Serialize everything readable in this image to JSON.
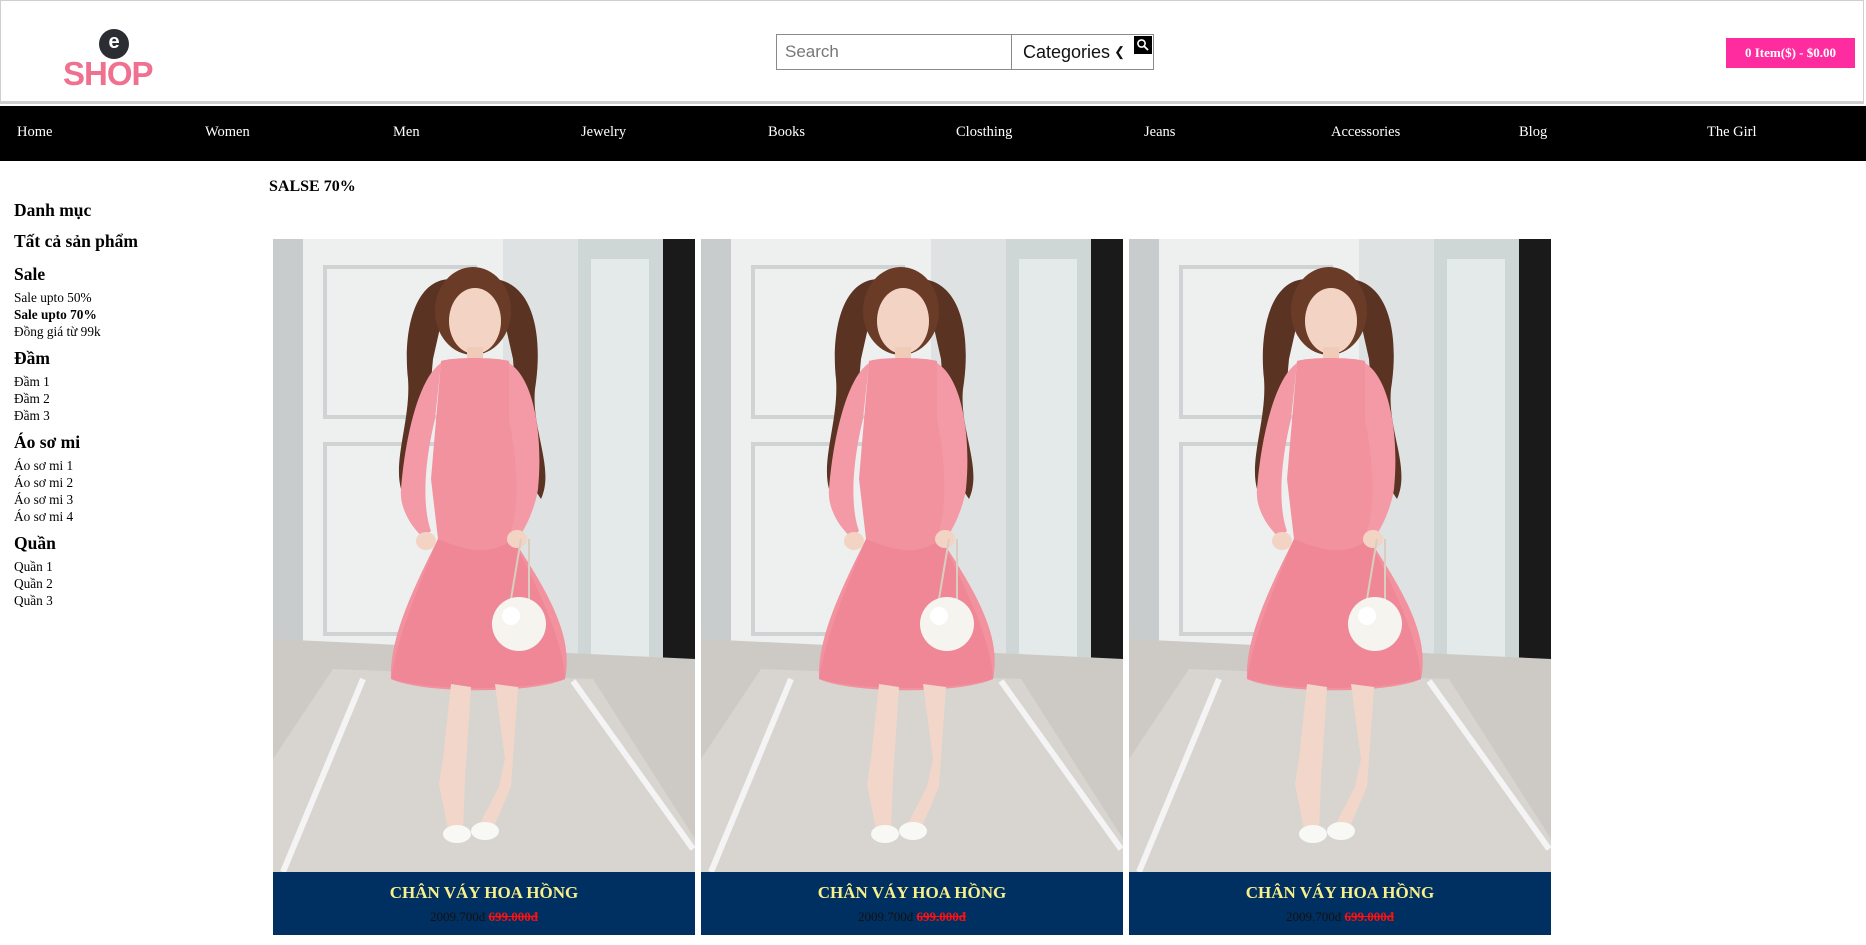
{
  "brand": {
    "logo_letter": "e",
    "logo_text": "SHOP"
  },
  "search": {
    "placeholder": "Search",
    "category_selected": "Categories"
  },
  "cart": {
    "label": "0 Item($) - $0.00"
  },
  "nav": {
    "items": [
      "Home",
      "Women",
      "Men",
      "Jewelry",
      "Books",
      "Closthing",
      "Jeans",
      "Accessories",
      "Blog",
      "The Girl"
    ]
  },
  "sidebar": {
    "title": "Danh mục",
    "all_products": "Tất cả sản phẩm",
    "groups": [
      {
        "heading": "Sale",
        "links": [
          "Sale upto 50%",
          "Sale upto 70%",
          "Đồng giá từ 99k"
        ]
      },
      {
        "heading": "Đầm",
        "links": [
          "Đầm 1",
          "Đầm 2",
          "Đầm 3"
        ]
      },
      {
        "heading": "Áo sơ mi",
        "links": [
          "Áo sơ mi 1",
          "Áo sơ mi 2",
          "Áo sơ mi 3",
          "Áo sơ mi 4"
        ]
      },
      {
        "heading": "Quần",
        "links": [
          "Quần 1",
          "Quần 2",
          "Quần 3"
        ]
      }
    ]
  },
  "section": {
    "title": "SALSE 70%"
  },
  "products": [
    {
      "name": "CHÂN VÁY HOA HỒNG",
      "price": "2009.700đ",
      "sale_price": "699.000đ"
    },
    {
      "name": "CHÂN VÁY HOA HỒNG",
      "price": "2009.700đ",
      "sale_price": "699.000đ"
    },
    {
      "name": "CHÂN VÁY HOA HỒNG",
      "price": "2009.700đ",
      "sale_price": "699.000đ"
    }
  ],
  "colors": {
    "accent": "#ff2ca0",
    "nav_bg": "#000000",
    "caption_bg": "#003061",
    "product_name": "#f9f08a",
    "sale_price": "#ff1010"
  }
}
